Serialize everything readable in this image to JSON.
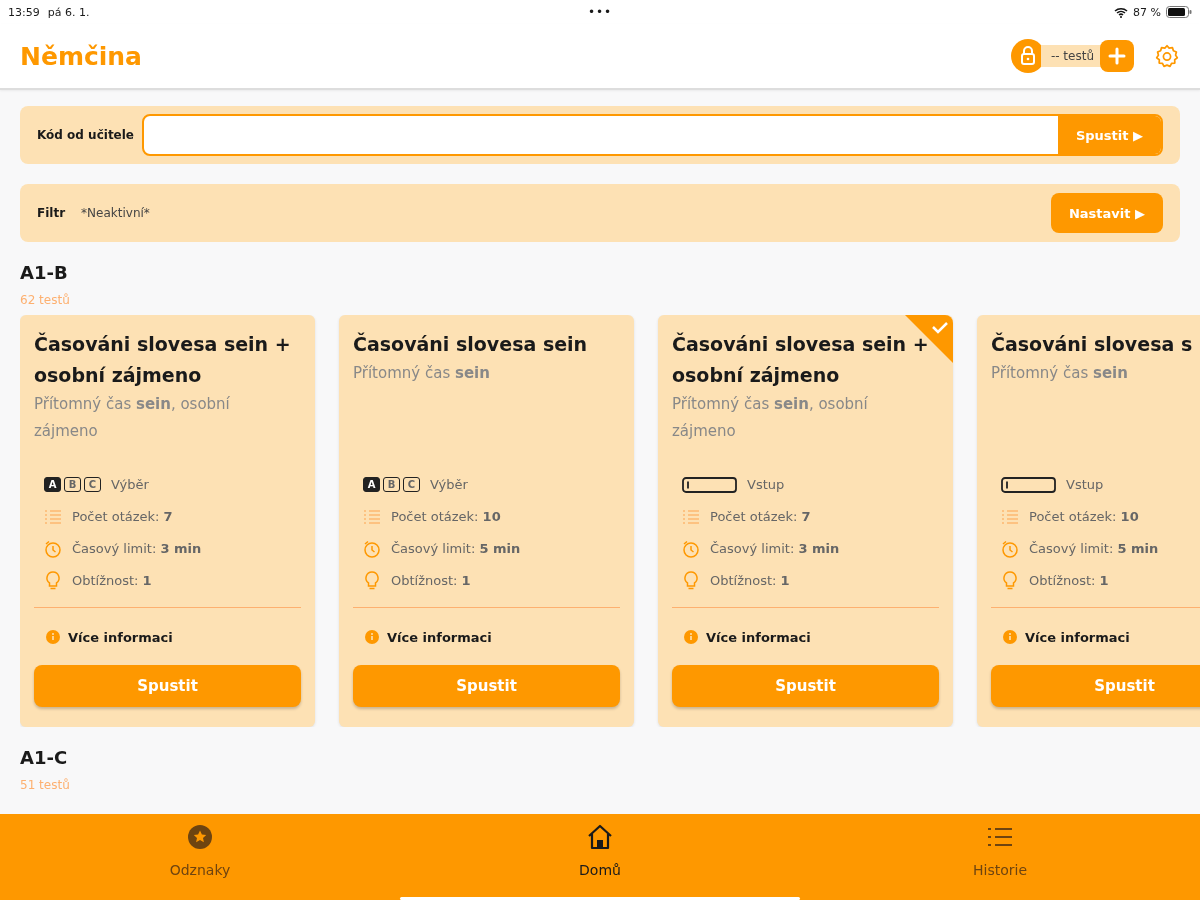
{
  "status_bar": {
    "time": "13:59",
    "date": "pá 6. 1.",
    "dots": "•••",
    "battery": "87 %"
  },
  "header": {
    "title": "Němčina",
    "tests_badge": "-- testů"
  },
  "code_panel": {
    "label": "Kód od učitele",
    "button": "Spustit ▶"
  },
  "filter_panel": {
    "label": "Filtr",
    "value": "*Neaktivní*",
    "button": "Nastavit ▶"
  },
  "sections": [
    {
      "title": "A1-B",
      "count": "62 testů",
      "cards": [
        {
          "title": "Časováni slovesa sein + osobní zájmeno",
          "subtitle": "Přítomný čas **sein**, osobní zájmeno",
          "answer": {
            "kind": "choice",
            "keys": [
              "A",
              "B",
              "C"
            ],
            "label": "Výběr"
          },
          "questions": "Počet otázek: **7**",
          "time_limit": "Časový limit: **3 min**",
          "difficulty": "Obtížnost: **1**",
          "more": "Více informaci",
          "button": "Spustit",
          "completed": false
        },
        {
          "title": "Časováni slovesa sein",
          "subtitle": "Přítomný čas **sein**",
          "answer": {
            "kind": "choice",
            "keys": [
              "A",
              "B",
              "C"
            ],
            "label": "Výběr"
          },
          "questions": "Počet otázek: **10**",
          "time_limit": "Časový limit: **5 min**",
          "difficulty": "Obtížnost: **1**",
          "more": "Více informaci",
          "button": "Spustit",
          "completed": false
        },
        {
          "title": "Časováni slovesa sein + osobní zájmeno",
          "subtitle": "Přítomný čas **sein**, osobní zájmeno",
          "answer": {
            "kind": "input",
            "label": "Vstup"
          },
          "questions": "Počet otázek: **7**",
          "time_limit": "Časový limit: **3 min**",
          "difficulty": "Obtížnost: **1**",
          "more": "Více informaci",
          "button": "Spustit",
          "completed": true
        },
        {
          "title": "Časováni slovesa s",
          "subtitle": "Přítomný čas **sein**",
          "answer": {
            "kind": "input",
            "label": "Vstup"
          },
          "questions": "Počet otázek: **10**",
          "time_limit": "Časový limit: **5 min**",
          "difficulty": "Obtížnost: **1**",
          "more": "Více informaci",
          "button": "Spustit",
          "completed": false
        }
      ]
    },
    {
      "title": "A1-C",
      "count": "51 testů"
    }
  ],
  "bottom_nav": [
    {
      "kind": "badges",
      "label": "Odznaky",
      "selected": false
    },
    {
      "kind": "home",
      "label": "Domů",
      "selected": true
    },
    {
      "kind": "history",
      "label": "Historie",
      "selected": false
    }
  ]
}
